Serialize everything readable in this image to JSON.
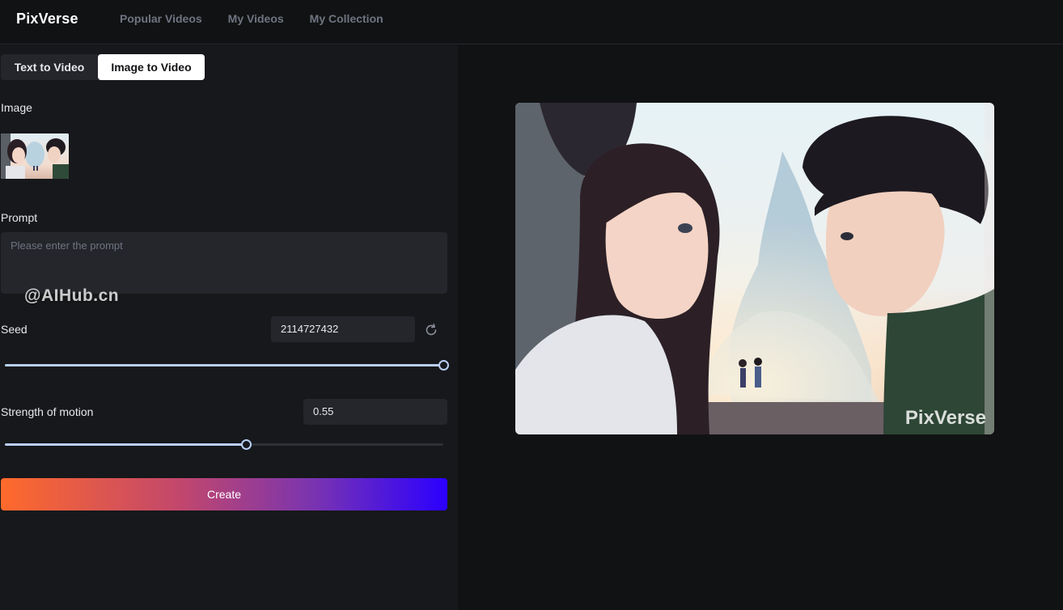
{
  "header": {
    "logo": "PixVerse",
    "nav": [
      "Popular Videos",
      "My Videos",
      "My Collection"
    ]
  },
  "tabs": [
    "Text to Video",
    "Image to Video"
  ],
  "active_tab": "Image to Video",
  "image_section": {
    "label": "Image"
  },
  "prompt_section": {
    "label": "Prompt",
    "placeholder": "Please enter the prompt",
    "value": ""
  },
  "watermark": "@AIHub.cn",
  "seed": {
    "label": "Seed",
    "value": "2114727432",
    "slider_fraction": 1.0
  },
  "motion": {
    "label": "Strength of motion",
    "value": "0.55",
    "slider_fraction": 0.55
  },
  "create_button": {
    "label": "Create"
  },
  "preview": {
    "watermark": "PixVerse"
  },
  "colors": {
    "accent_slider": "#b9cff5",
    "create_gradient_start": "#ff6a2b",
    "create_gradient_end": "#2b00ff",
    "panel_bg": "#17181b"
  }
}
